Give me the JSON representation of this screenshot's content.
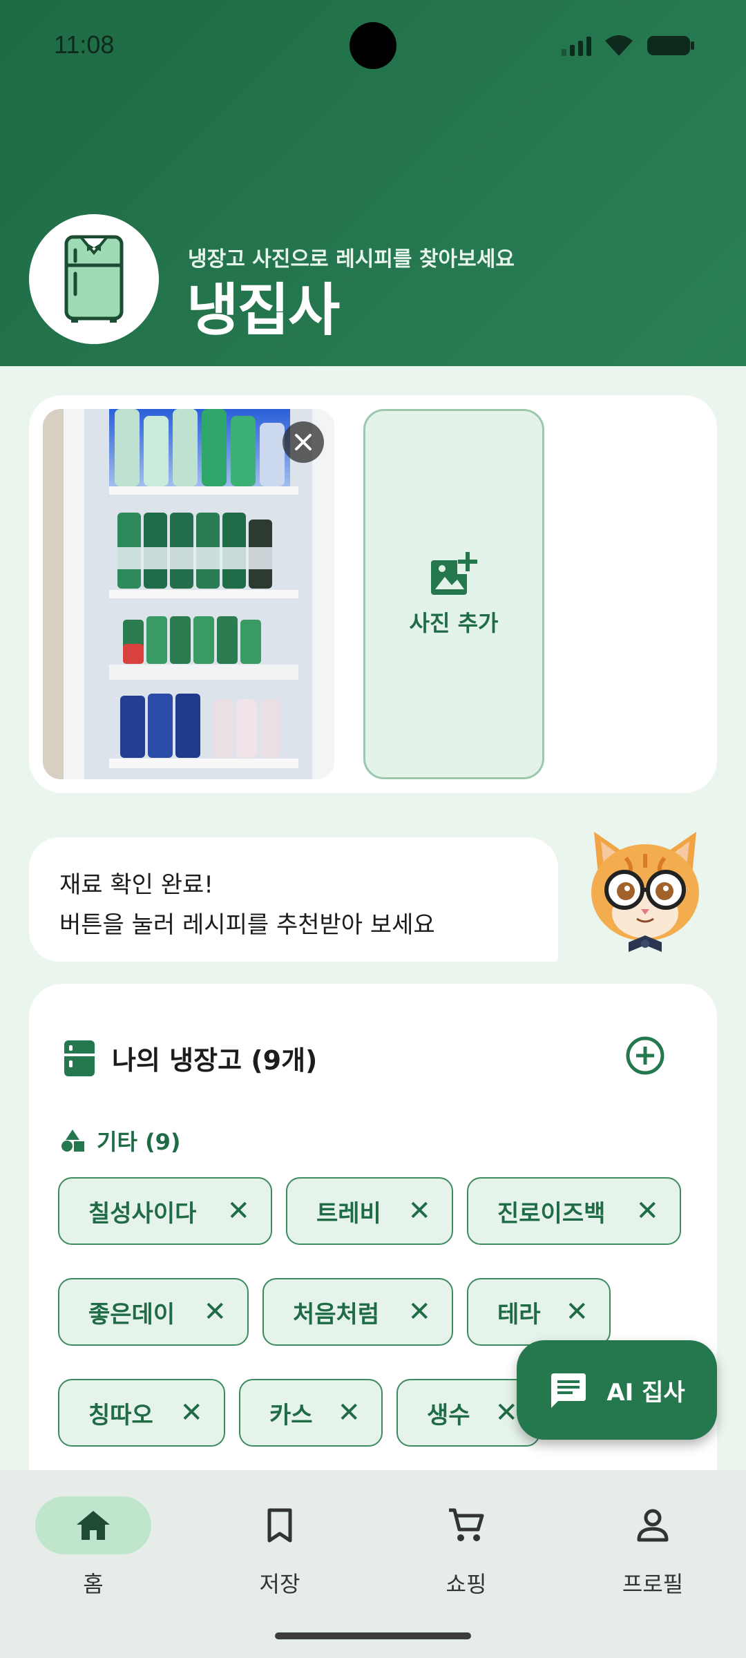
{
  "status_bar": {
    "time": "11:08"
  },
  "header": {
    "subtitle": "냉장고 사진으로 레시피를 찾아보세요",
    "title": "냉집사"
  },
  "photos": {
    "add_label": "사진 추가"
  },
  "message": {
    "line1": "재료 확인 완료!",
    "line2": "버튼을 눌러 레시피를 추천받아 보세요"
  },
  "fridge": {
    "title": "나의 냉장고 (9개)",
    "category_label": "기타 (9)",
    "items": [
      {
        "label": "칠성사이다"
      },
      {
        "label": "트레비"
      },
      {
        "label": "진로이즈백"
      },
      {
        "label": "좋은데이"
      },
      {
        "label": "처음처럼"
      },
      {
        "label": "테라"
      },
      {
        "label": "칭따오"
      },
      {
        "label": "카스"
      },
      {
        "label": "생수"
      }
    ]
  },
  "fab": {
    "label": "AI 집사"
  },
  "nav": {
    "items": [
      {
        "label": "홈",
        "icon": "home-icon",
        "active": true
      },
      {
        "label": "저장",
        "icon": "bookmark-icon",
        "active": false
      },
      {
        "label": "쇼핑",
        "icon": "cart-icon",
        "active": false
      },
      {
        "label": "프로필",
        "icon": "person-icon",
        "active": false
      }
    ]
  },
  "colors": {
    "primary": "#25784d",
    "header": "#1e6a44",
    "chip_bg": "#e6f3ea",
    "background": "#eaf5ee"
  }
}
